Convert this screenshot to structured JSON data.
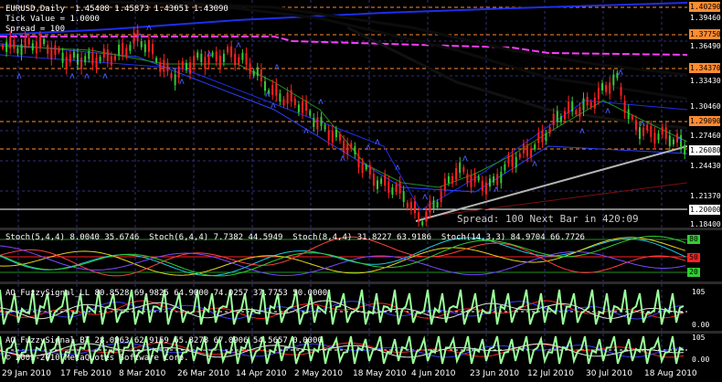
{
  "main": {
    "symbol_line": "EURUSD,Daily  1.45408 1.45873 1.43051 1.43090",
    "tick_value": "Tick Value = 1.0000",
    "spread_line": "Spread = 100",
    "spread_overlay": "Spread: 100 Next Bar in 420:09",
    "price_labels": [
      {
        "text": "1.40290",
        "boxed": true,
        "color": "#ff8c32"
      },
      {
        "text": "1.39460",
        "boxed": false,
        "color": ""
      },
      {
        "text": "1.37750",
        "boxed": true,
        "color": "#ff8c32"
      },
      {
        "text": "1.36490",
        "boxed": false,
        "color": ""
      },
      {
        "text": "1.34370",
        "boxed": true,
        "color": "#ff8c32"
      },
      {
        "text": "1.33430",
        "boxed": false,
        "color": ""
      },
      {
        "text": "1.30460",
        "boxed": false,
        "color": ""
      },
      {
        "text": "1.29090",
        "boxed": true,
        "color": "#ff8c32"
      },
      {
        "text": "1.27460",
        "boxed": false,
        "color": ""
      },
      {
        "text": "1.26080",
        "boxed": true,
        "color": "#ffffff"
      },
      {
        "text": "1.24430",
        "boxed": false,
        "color": ""
      },
      {
        "text": "1.21370",
        "boxed": false,
        "color": ""
      },
      {
        "text": "1.20000",
        "boxed": true,
        "color": "#ffffff"
      },
      {
        "text": "1.18400",
        "boxed": false,
        "color": ""
      }
    ]
  },
  "stoch": {
    "label": "Stoch(5,4,4) 8.0040 35.6746  Stoch(6,4,4) 7.7382 44.5949  Stoch(8,4,4) 31.8227 63.9186  Stoch(14,3,3) 84.9704 66.7726",
    "levels": [
      "80",
      "50",
      "20"
    ]
  },
  "fuzzy1": {
    "label": "AO_FuzzySignal_LL 80.8528 69.9825 64.9000 74.0257 37.7753 50.0000",
    "axis_top": "105",
    "axis_bottom": "0.00"
  },
  "fuzzy2": {
    "label": "AO_FuzzySignal_BT 28.0963 62.9159 65.8278 67.0906 54.5657 0.0000",
    "copyright": "© 2001-2010 MetaQuotes Software Corp.",
    "axis_top": "105",
    "axis_bottom": "0.00"
  },
  "x_axis": [
    "29 Jan 2010",
    "17 Feb 2010",
    "8 Mar 2010",
    "26 Mar 2010",
    "14 Apr 2010",
    "2 May 2010",
    "18 May 2010",
    "4 Jun 2010",
    "23 Jun 2010",
    "12 Jul 2010",
    "30 Jul 2010",
    "18 Aug 2010"
  ],
  "colors": {
    "background": "#000000",
    "bull": "#32cd32",
    "bear": "#ff2020",
    "grid": "#2f2f7a",
    "resistance": "#ff8c32",
    "ma_blue": "#1e2eea",
    "magenta": "#ff3cff",
    "trendline": "#b4b4b4",
    "fuzzy_green": "#9aff9a",
    "stoch_cyan": "#1ec8e6",
    "stoch_yellow": "#e6d21e"
  },
  "icons": [
    "fractal-up-marker",
    "fractal-down-marker"
  ]
}
